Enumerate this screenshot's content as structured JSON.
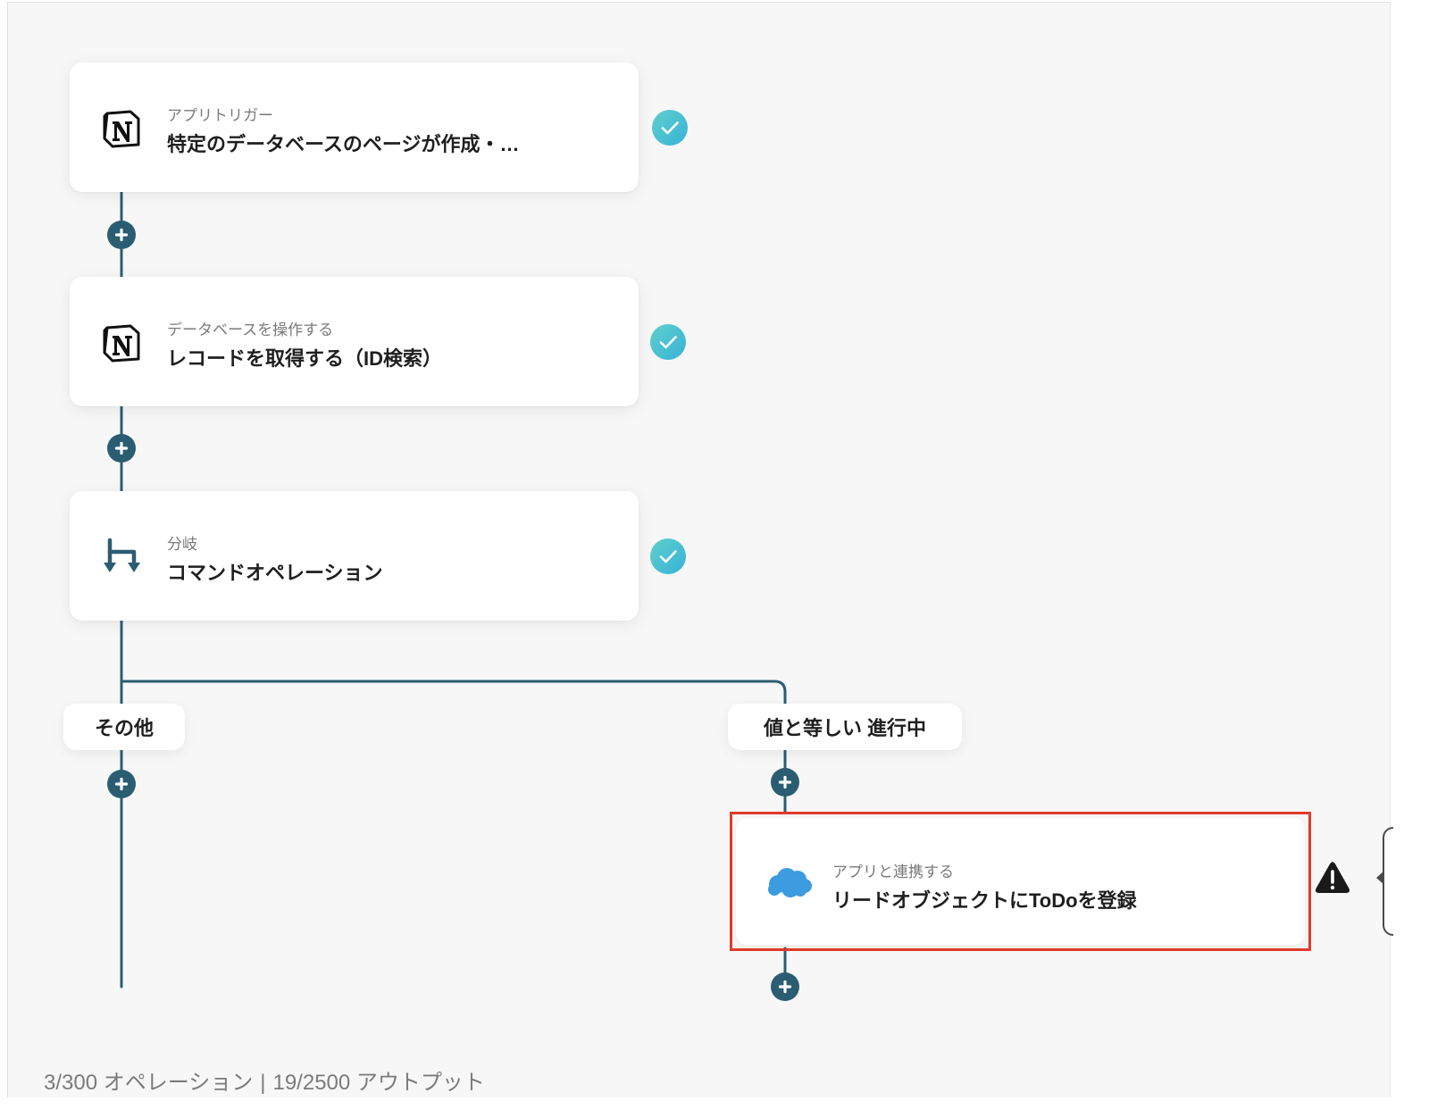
{
  "nodes": [
    {
      "subtitle": "アプリトリガー",
      "title": "特定のデータベースのページが作成・…",
      "icon": "notion-icon",
      "status": "completed"
    },
    {
      "subtitle": "データベースを操作する",
      "title": "レコードを取得する（ID検索）",
      "icon": "notion-icon",
      "status": "completed"
    },
    {
      "subtitle": "分岐",
      "title": "コマンドオペレーション",
      "icon": "branch-icon",
      "status": "completed"
    }
  ],
  "branches": [
    {
      "label": "その他"
    },
    {
      "label": "値と等しい 進行中"
    }
  ],
  "branch_node": {
    "subtitle": "アプリと連携する",
    "title": "リードオブジェクトにToDoを登録",
    "icon": "salesforce-icon",
    "status": "warning"
  },
  "footer": {
    "operations": "3/300 オペレーション",
    "separator": "|",
    "outputs": "19/2500 アウトプット"
  },
  "colors": {
    "connector": "#2b5d72",
    "check_start": "#5fd0cc",
    "check_end": "#38b2d8",
    "highlight": "#e03a2a",
    "salesforce": "#3d9be0",
    "background": "#f7f7f7"
  }
}
